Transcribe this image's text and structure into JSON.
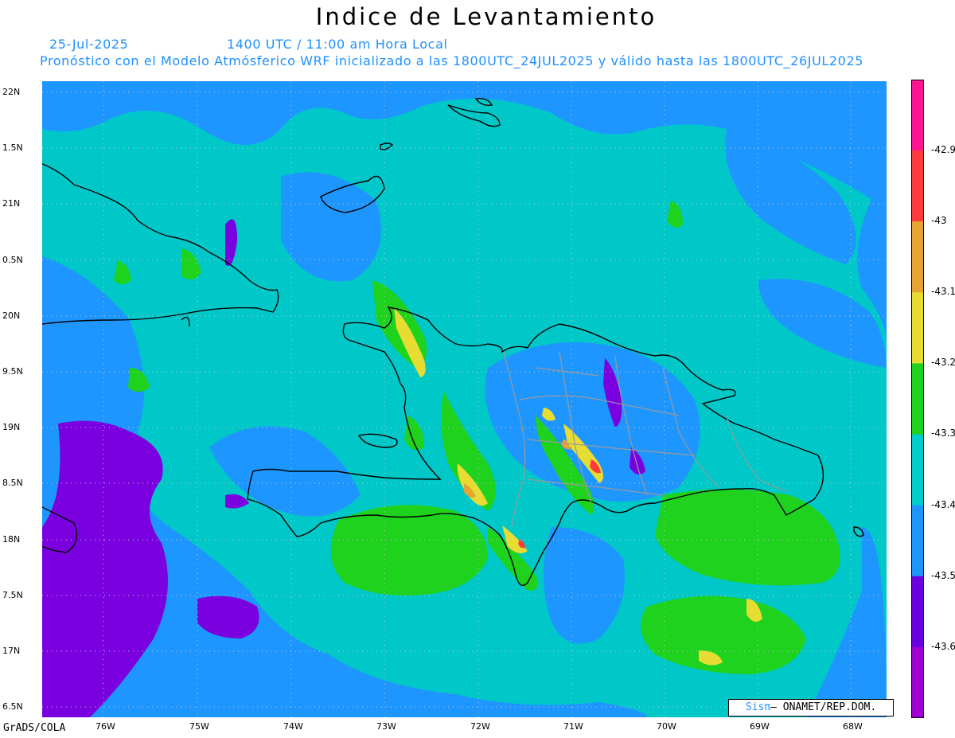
{
  "title": "Indice de Levantamiento",
  "subtitle": {
    "date": "25-Jul-2025",
    "time": "1400 UTC / 11:00 am Hora Local",
    "forecast": "Pronóstico con el Modelo Atmósferico WRF inicializado a las 1800UTC_24JUL2025 y válido hasta las  1800UTC_26JUL2025"
  },
  "credit": "GrADS/COLA",
  "attribution": {
    "brand": "Sisπ",
    "text": " ONAMET/REP.DOM."
  },
  "lat_labels": [
    "22N",
    "1.5N",
    "21N",
    "0.5N",
    "20N",
    "9.5N",
    "19N",
    "8.5N",
    "18N",
    "7.5N",
    "17N",
    "6.5N"
  ],
  "lon_labels": [
    "76W",
    "75W",
    "74W",
    "73W",
    "72W",
    "71W",
    "70W",
    "69W",
    "68W"
  ],
  "colorbar": {
    "labels": [
      "-42.9",
      "-43",
      "-43.1",
      "-43.2",
      "-43.3",
      "-43.4",
      "-43.5",
      "-43.6"
    ],
    "colors": [
      "#ff1493",
      "#ff3c3c",
      "#e6a532",
      "#e6dc32",
      "#1ed21e",
      "#00cccc",
      "#1e96ff",
      "#6a00e0",
      "#a000d2"
    ]
  },
  "colors": {
    "subtitle": "#1e90ff",
    "ocean": "#00c8c8",
    "grid": "#c8c8c8"
  }
}
